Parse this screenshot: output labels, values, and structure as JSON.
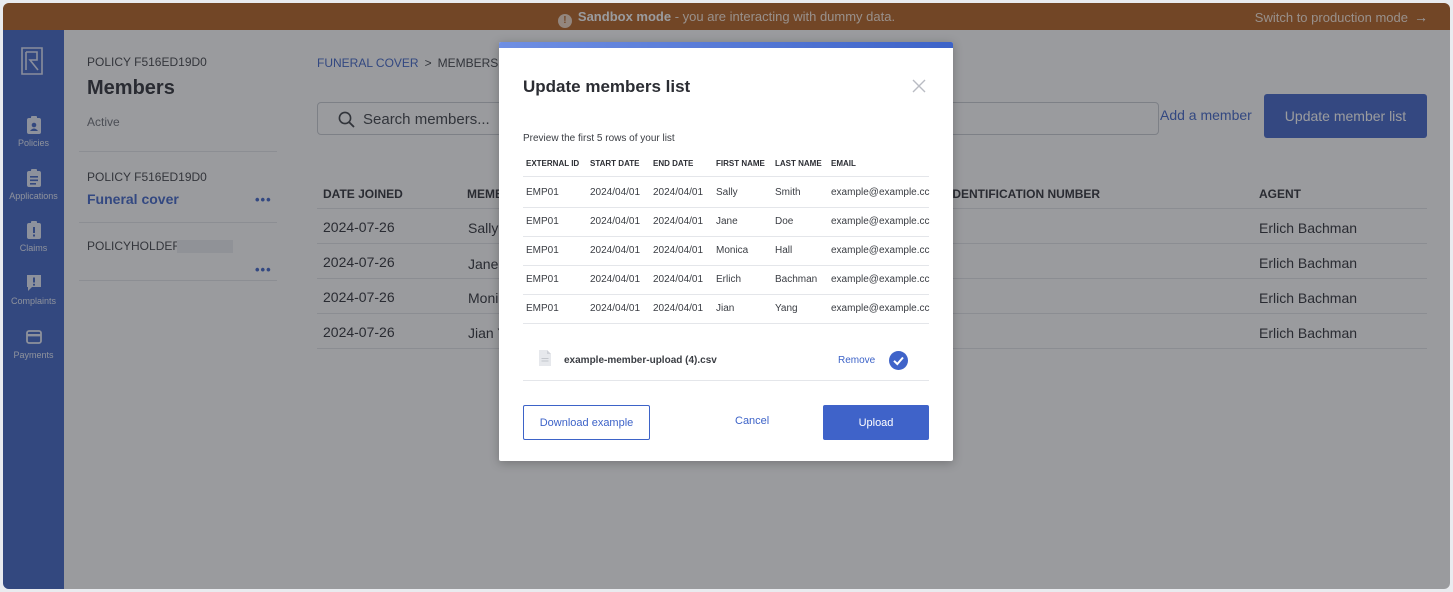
{
  "banner": {
    "bold": "Sandbox mode",
    "rest": " - you are interacting with dummy data.",
    "switch_label": "Switch to production mode",
    "switch_arrow": "→"
  },
  "nav": {
    "items": [
      {
        "label": "Policies",
        "icon": "clipboard-person-icon"
      },
      {
        "label": "Applications",
        "icon": "clipboard-list-icon"
      },
      {
        "label": "Claims",
        "icon": "clipboard-alert-icon"
      },
      {
        "label": "Complaints",
        "icon": "speech-alert-icon"
      },
      {
        "label": "Payments",
        "icon": "credit-card-icon"
      }
    ]
  },
  "side": {
    "policy_label": "POLICY F516ED19D0",
    "title": "Members",
    "status": "Active",
    "policy_label2": "POLICY F516ED19D0",
    "product_link": "Funeral cover",
    "more1": "•••",
    "policyholder_label": "POLICYHOLDER",
    "more2": "•••"
  },
  "main": {
    "breadcrumb": {
      "parent": "FUNERAL COVER",
      "sep": ">",
      "current": "MEMBERS"
    },
    "search_placeholder": "Search members...",
    "add_member": "Add a member",
    "update_button": "Update member list",
    "columns": {
      "date_joined": "DATE JOINED",
      "member": "MEMB",
      "id_number": "IDENTIFICATION NUMBER",
      "agent": "AGENT"
    },
    "rows": [
      {
        "date": "2024-07-26",
        "member": "Sally S",
        "agent": "Erlich Bachman"
      },
      {
        "date": "2024-07-26",
        "member": "Jane d",
        "agent": "Erlich Bachman"
      },
      {
        "date": "2024-07-26",
        "member": "Monic",
        "agent": "Erlich Bachman"
      },
      {
        "date": "2024-07-26",
        "member": "Jian Y",
        "agent": "Erlich Bachman"
      }
    ]
  },
  "modal": {
    "title": "Update members list",
    "preview_text": "Preview the first 5 rows of your list",
    "columns": [
      "EXTERNAL ID",
      "START DATE",
      "END DATE",
      "FIRST NAME",
      "LAST NAME",
      "EMAIL"
    ],
    "rows": [
      [
        "EMP01",
        "2024/04/01",
        "2024/04/01",
        "Sally",
        "Smith",
        "example@example.cc"
      ],
      [
        "EMP01",
        "2024/04/01",
        "2024/04/01",
        "Jane",
        "Doe",
        "example@example.cc"
      ],
      [
        "EMP01",
        "2024/04/01",
        "2024/04/01",
        "Monica",
        "Hall",
        "example@example.cc"
      ],
      [
        "EMP01",
        "2024/04/01",
        "2024/04/01",
        "Erlich",
        "Bachman",
        "example@example.cc"
      ],
      [
        "EMP01",
        "2024/04/01",
        "2024/04/01",
        "Jian",
        "Yang",
        "example@example.cc"
      ]
    ],
    "file_name": "example-member-upload (4).csv",
    "remove_label": "Remove",
    "download_label": "Download example",
    "cancel_label": "Cancel",
    "upload_label": "Upload"
  },
  "colors": {
    "banner": "#b35f1e",
    "nav": "#3e63c4",
    "accent": "#3d63c8"
  }
}
